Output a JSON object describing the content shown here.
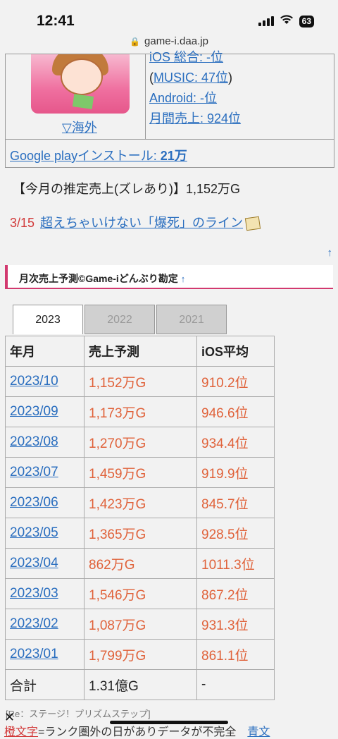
{
  "status": {
    "time": "12:41",
    "battery": "63"
  },
  "url": "game-i.daa.jp",
  "ranks": {
    "ios_overall": "iOS 総合: -位",
    "music_open": "(",
    "music": "MUSIC: 47位",
    "music_close": ")",
    "android": "Android: -位",
    "monthly_sales": "月間売上: 924位"
  },
  "overseas_link": "▽海外",
  "google_play": {
    "label": "Google playインストール: ",
    "value": "21万"
  },
  "estimate_text": "【今月の推定売上(ズレあり)】1,152万G",
  "deadline": {
    "date": "3/15",
    "link": "超えちゃいけない「爆死」のライン"
  },
  "back_to_top": "↑",
  "section": {
    "title": "月次売上予測©Game-iどんぶり勘定",
    "anchor": "↑"
  },
  "tabs": [
    {
      "label": "2023",
      "active": true
    },
    {
      "label": "2022",
      "active": false
    },
    {
      "label": "2021",
      "active": false
    }
  ],
  "table": {
    "headers": [
      "年月",
      "売上予測",
      "iOS平均"
    ],
    "rows": [
      [
        "2023/10",
        "1,152万G",
        "910.2位"
      ],
      [
        "2023/09",
        "1,173万G",
        "946.6位"
      ],
      [
        "2023/08",
        "1,270万G",
        "934.4位"
      ],
      [
        "2023/07",
        "1,459万G",
        "919.9位"
      ],
      [
        "2023/06",
        "1,423万G",
        "845.7位"
      ],
      [
        "2023/05",
        "1,365万G",
        "928.5位"
      ],
      [
        "2023/04",
        "862万G",
        "1011.3位"
      ],
      [
        "2023/03",
        "1,546万G",
        "867.2位"
      ],
      [
        "2023/02",
        "1,087万G",
        "931.3位"
      ],
      [
        "2023/01",
        "1,799万G",
        "861.1位"
      ]
    ],
    "total": [
      "合計",
      "1.31億G",
      "-"
    ]
  },
  "footer": {
    "title": "[Re：ステージ！プリズムステップ]",
    "red_text": "橙文字",
    "text": "=ランク圏外の日がありデータが不完全",
    "link": "青文"
  },
  "colors": {
    "accent": "#d2396f",
    "link": "#2a6ebf",
    "sales": "#e0623a",
    "date_red": "#d23a3a"
  }
}
